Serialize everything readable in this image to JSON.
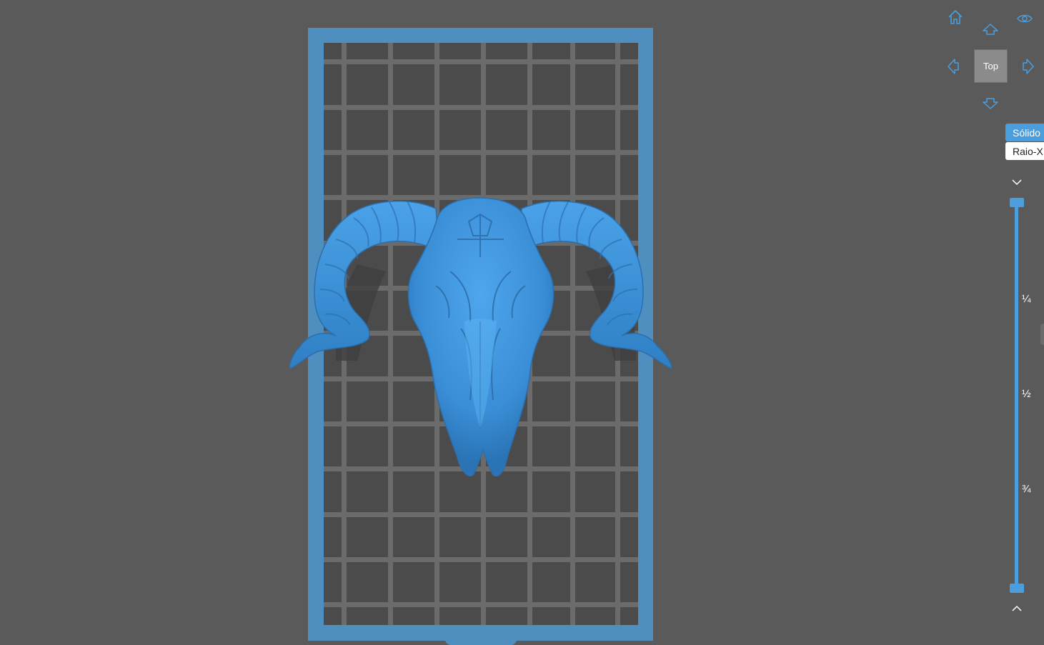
{
  "navigation": {
    "home_icon": "home-icon",
    "visibility_icon": "eye-icon",
    "current_view_label": "Top",
    "arrow_up_icon": "arrow-up-icon",
    "arrow_down_icon": "arrow-down-icon",
    "arrow_left_icon": "arrow-left-icon",
    "arrow_right_icon": "arrow-right-icon"
  },
  "render_mode": {
    "solid_label": "Sólido",
    "xray_label": "Raio-X",
    "selected": "Sólido"
  },
  "layer_slider": {
    "marks": [
      "¼",
      "½",
      "¾"
    ],
    "upper_value": 0,
    "lower_value": 1,
    "collapse_icon": "chevron-down-icon",
    "expand_icon": "chevron-up-icon"
  },
  "colors": {
    "accent": "#4a9ede",
    "plate": "#4e8fc0",
    "model": "#3b8fd6",
    "background": "#5a5a5a"
  }
}
